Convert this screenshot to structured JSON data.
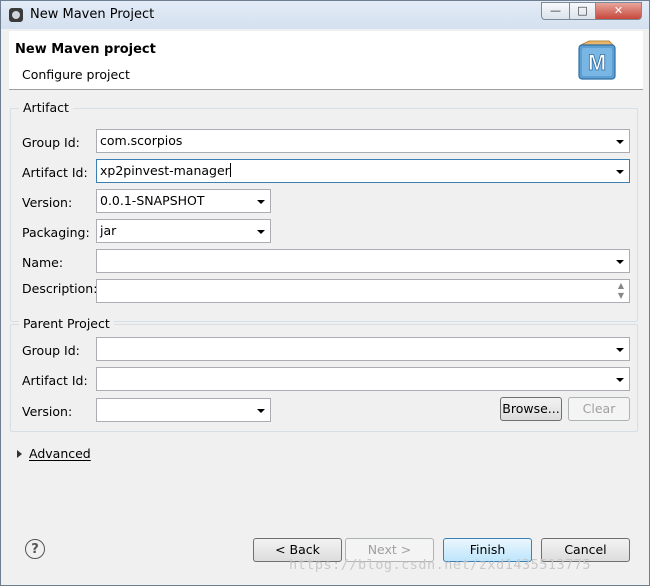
{
  "window": {
    "title": "New Maven Project",
    "controls": {
      "minimize": "—",
      "maximize": "□",
      "close": "✕"
    }
  },
  "header": {
    "title": "New Maven project",
    "subtitle": "Configure project",
    "logo_icon": "maven-m-icon",
    "logo_letter": "M"
  },
  "artifact": {
    "legend": "Artifact",
    "group_id": {
      "label": "Group Id:",
      "value": "com.scorpios"
    },
    "artifact_id": {
      "label": "Artifact Id:",
      "value": "xp2pinvest-manager"
    },
    "version": {
      "label": "Version:",
      "value": "0.0.1-SNAPSHOT"
    },
    "packaging": {
      "label": "Packaging:",
      "value": "jar"
    },
    "name": {
      "label": "Name:",
      "value": ""
    },
    "description": {
      "label": "Description:",
      "value": ""
    }
  },
  "parent": {
    "legend": "Parent Project",
    "group_id": {
      "label": "Group Id:",
      "value": ""
    },
    "artifact_id": {
      "label": "Artifact Id:",
      "value": ""
    },
    "version": {
      "label": "Version:",
      "value": ""
    },
    "browse_label": "Browse...",
    "clear_label": "Clear"
  },
  "advanced": {
    "label": "Advanced"
  },
  "footer": {
    "help_icon": "help-icon",
    "help_glyph": "?",
    "back_label": "< Back",
    "next_label": "Next >",
    "finish_label": "Finish",
    "cancel_label": "Cancel"
  },
  "watermark": "https://blog.csdn.net/zxd1435513775"
}
